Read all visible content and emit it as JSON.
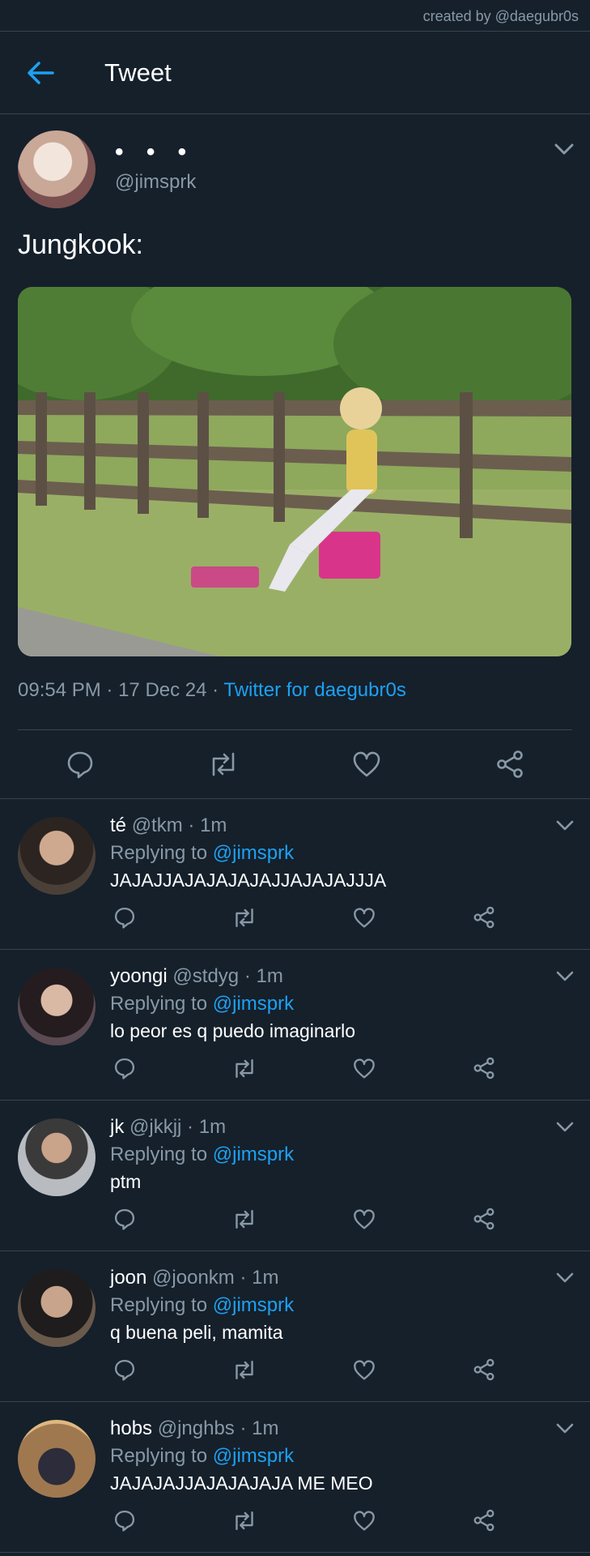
{
  "credit": "created by @daegubr0s",
  "header": {
    "title": "Tweet"
  },
  "tweet": {
    "display_name": "• • •",
    "handle": "@jimsprk",
    "text": "Jungkook:",
    "time": "09:54 PM",
    "date": "17 Dec 24",
    "source": "Twitter for daegubr0s"
  },
  "replies": [
    {
      "name": "té",
      "handle": "@tkm",
      "time": "1m",
      "replying_label": "Replying to",
      "mention": "@jimsprk",
      "text": "JAJAJJAJAJAJAJAJJAJAJAJJJA"
    },
    {
      "name": "yoongi",
      "handle": "@stdyg",
      "time": "1m",
      "replying_label": "Replying to",
      "mention": "@jimsprk",
      "text": "lo peor es q puedo imaginarlo"
    },
    {
      "name": "jk",
      "handle": "@jkkjj",
      "time": "1m",
      "replying_label": "Replying to",
      "mention": "@jimsprk",
      "text": "ptm"
    },
    {
      "name": "joon",
      "handle": "@joonkm",
      "time": "1m",
      "replying_label": "Replying to",
      "mention": "@jimsprk",
      "text": "q buena peli, mamita"
    },
    {
      "name": "hobs",
      "handle": "@jnghbs",
      "time": "1m",
      "replying_label": "Replying to",
      "mention": "@jimsprk",
      "text": "JAJAJAJJAJAJAJAJA ME MEO"
    }
  ],
  "colors": {
    "background": "#15202b",
    "accent": "#1da1f2",
    "muted": "#8899a6",
    "divider": "#38444d"
  },
  "icons": [
    "back-arrow-icon",
    "chevron-down-icon",
    "reply-icon",
    "retweet-icon",
    "like-icon",
    "share-icon"
  ]
}
